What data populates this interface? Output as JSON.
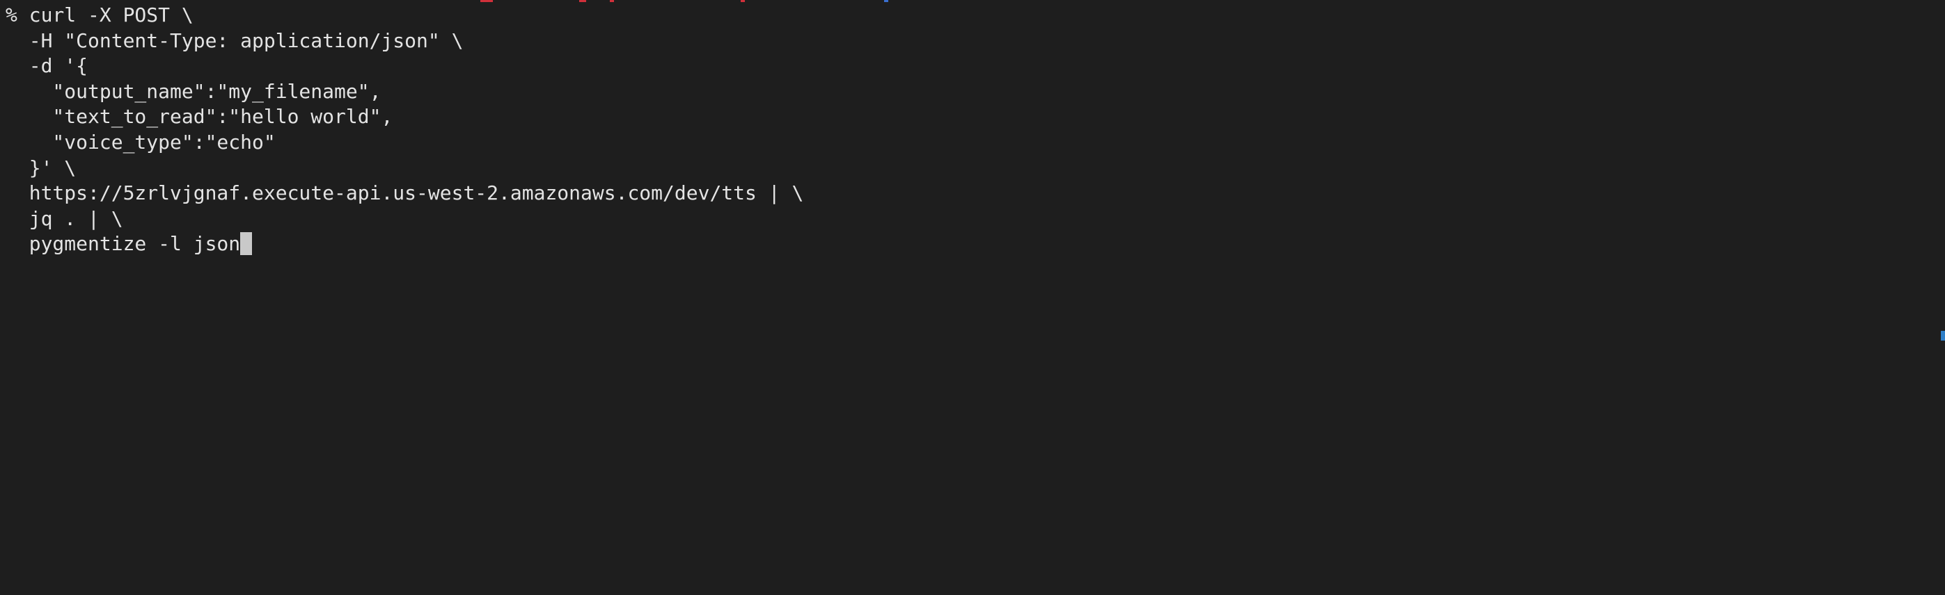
{
  "terminal": {
    "lines": [
      "% curl -X POST \\",
      "  -H \"Content-Type: application/json\" \\",
      "  -d '{",
      "    \"output_name\":\"my_filename\",",
      "    \"text_to_read\":\"hello world\",",
      "    \"voice_type\":\"echo\"",
      "  }' \\",
      "  https://5zrlvjgnaf.execute-api.us-west-2.amazonaws.com/dev/tts | \\",
      "  jq . | \\",
      "  pygmentize -l json"
    ]
  },
  "colors": {
    "background": "#1e1e1e",
    "text": "#e4e4e4",
    "cursor": "#c9c9c9",
    "scroll_marker": "#2f7fc8",
    "artifact_red": "#d0303a",
    "artifact_blue": "#3a6fd0"
  }
}
